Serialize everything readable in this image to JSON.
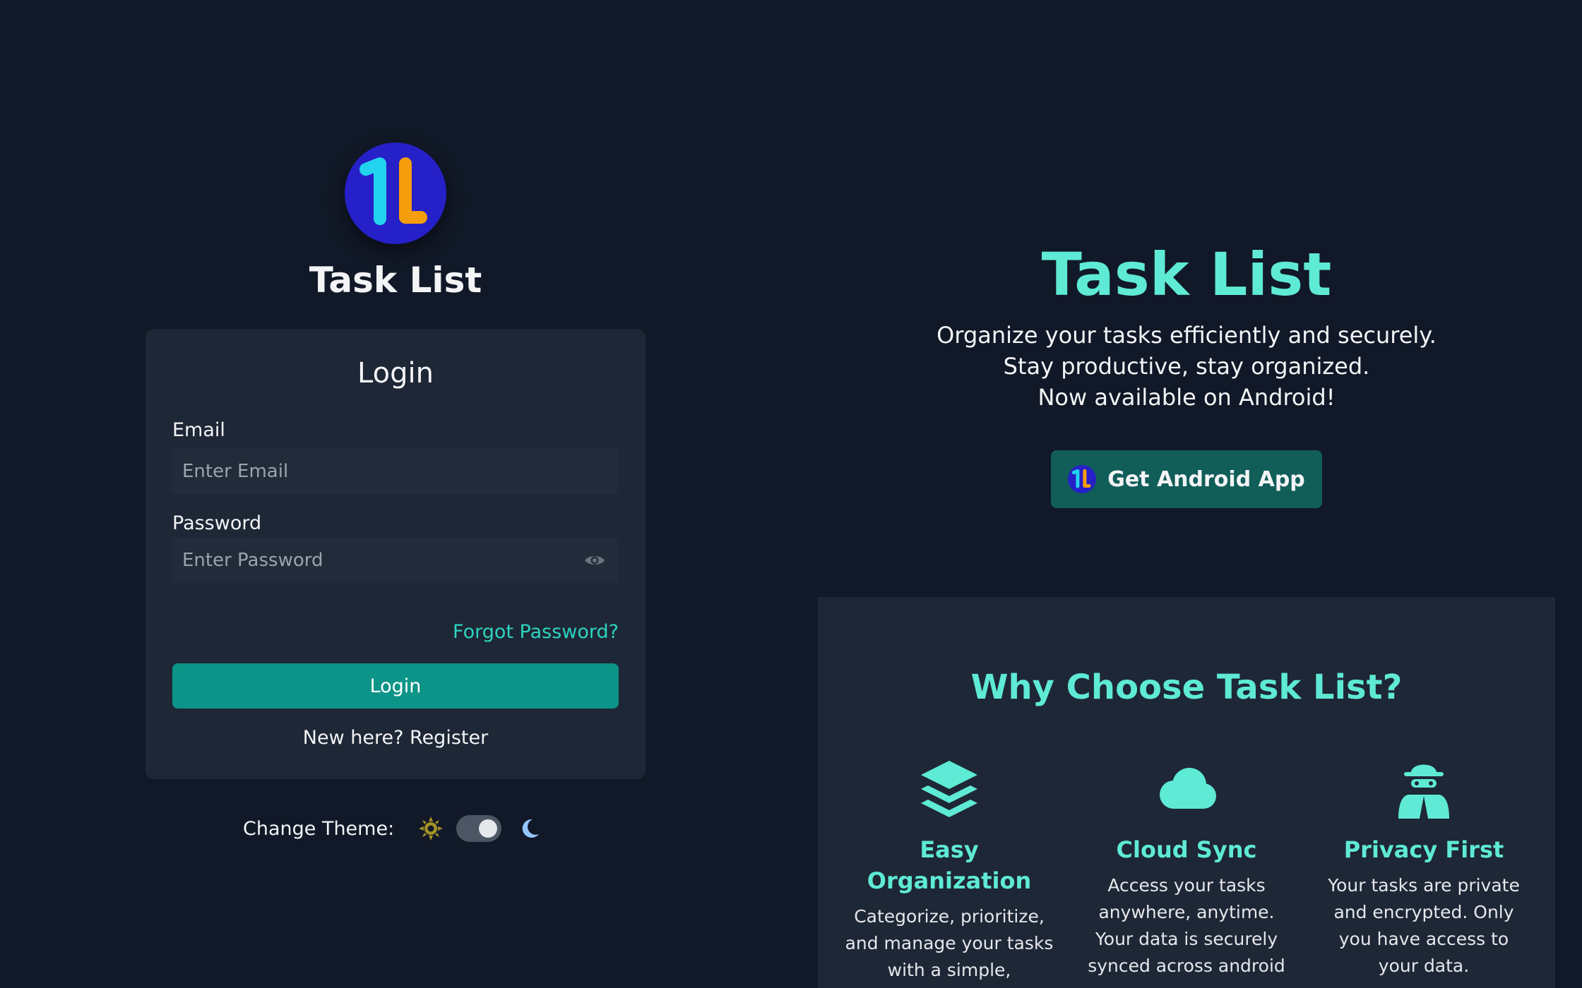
{
  "brand": {
    "logo_icon": "task-list-logo",
    "app_title": "Task List"
  },
  "login": {
    "title": "Login",
    "email_label": "Email",
    "email_placeholder": "Enter Email",
    "email_value": "",
    "password_label": "Password",
    "password_placeholder": "Enter Password",
    "password_value": "",
    "show_password_icon": "eye-icon",
    "forgot_link": "Forgot Password?",
    "submit_label": "Login",
    "register_text": "New here? Register"
  },
  "theme": {
    "label": "Change Theme:",
    "light_icon": "sun-icon",
    "dark_icon": "moon-icon",
    "mode": "dark"
  },
  "hero": {
    "title": "Task List",
    "lines": [
      "Organize your tasks efficiently and securely.",
      "Stay productive, stay organized.",
      "Now available on Android!"
    ],
    "android_button": "Get Android App"
  },
  "features": {
    "title": "Why Choose Task List?",
    "items": [
      {
        "icon": "layers-icon",
        "title": "Easy Organization",
        "description": "Categorize, prioritize, and manage your tasks with a simple,"
      },
      {
        "icon": "cloud-icon",
        "title": "Cloud Sync",
        "description": "Access your tasks anywhere, anytime. Your data is securely synced across android"
      },
      {
        "icon": "spy-icon",
        "title": "Privacy First",
        "description": "Your tasks are private and encrypted. Only you have access to your data."
      }
    ]
  },
  "colors": {
    "background": "#111827",
    "card": "#1e2736",
    "accent": "#5eead4",
    "primary_button": "#0d9488",
    "link": "#2dd4bf",
    "logo_blue": "#2620c8",
    "logo_cyan": "#22d3ee",
    "logo_orange": "#f59e0b"
  }
}
